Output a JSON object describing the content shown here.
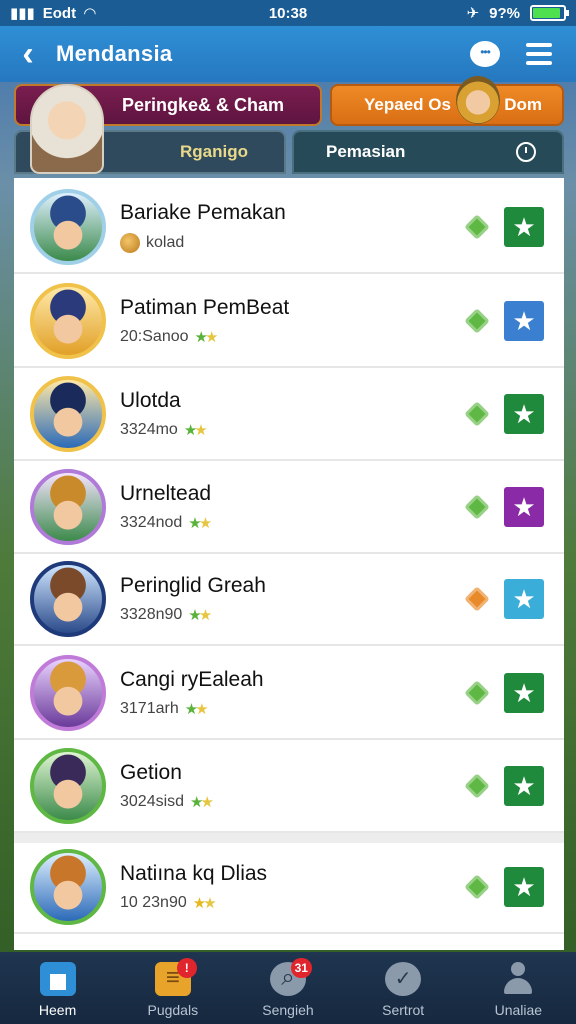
{
  "status_bar": {
    "carrier": "Eodt",
    "time": "10:38",
    "battery": "9?%",
    "battery_level_percent": 90
  },
  "header": {
    "title": "Mendansia"
  },
  "banner": {
    "left_label": "Peringke& & Cham",
    "right_label": "Yepaed Os",
    "right_extra": "Dom"
  },
  "tabs": [
    {
      "label": "Rganigo"
    },
    {
      "label": "Pemasian"
    }
  ],
  "list": [
    {
      "name": "Bariake Pemakan",
      "subtitle": "kolad",
      "sub_icon": "coin",
      "avatar_ring": "#9fd0e8",
      "hat": "#2a4c8a",
      "bg1": "#dff0ff",
      "bg2": "#3b8a4a",
      "diamond_color": "#5fb844",
      "button_color": "#1f8a3c"
    },
    {
      "name": "Patiman PemBeat",
      "subtitle": "20:Sanoo",
      "sub_icon": "stars",
      "avatar_ring": "#f0c24a",
      "hat": "#2a3a7a",
      "bg1": "#ffe9a8",
      "bg2": "#e1a028",
      "diamond_color": "#5fb844",
      "button_color": "#3a7fd0"
    },
    {
      "name": "Ulotda",
      "subtitle": "3324mo",
      "sub_icon": "stars",
      "avatar_ring": "#f0c24a",
      "hat": "#1a2a5a",
      "bg1": "#ffe9a8",
      "bg2": "#2b6ab8",
      "diamond_color": "#5fb844",
      "button_color": "#1f8a3c"
    },
    {
      "name": "Urneltead",
      "subtitle": "3324nod",
      "sub_icon": "stars",
      "avatar_ring": "#b07ad8",
      "hat": "#c88a2a",
      "bg1": "#f5e4ff",
      "bg2": "#3b8a4a",
      "diamond_color": "#5fb844",
      "button_color": "#8a2aa6"
    },
    {
      "name": "Peringlid Greah",
      "subtitle": "3328n90",
      "sub_icon": "stars",
      "avatar_ring": "#1e3a7a",
      "hat": "#7a4a2a",
      "bg1": "#cfe6ff",
      "bg2": "#2a4a8a",
      "diamond_color": "#e88a2a",
      "button_color": "#3aaed8"
    },
    {
      "name": "Cangi ryEaleah",
      "subtitle": "3171arh",
      "sub_icon": "stars",
      "avatar_ring": "#c07ad8",
      "hat": "#d89a3a",
      "bg1": "#e9d2ff",
      "bg2": "#6a3a9a",
      "diamond_color": "#5fb844",
      "button_color": "#1f8a3c"
    },
    {
      "name": "Getion",
      "subtitle": "3024sisd",
      "sub_icon": "stars",
      "avatar_ring": "#5fb844",
      "hat": "#3a2a5a",
      "bg1": "#dff5d2",
      "bg2": "#3b8a4a",
      "diamond_color": "#5fb844",
      "button_color": "#1f8a3c"
    },
    {
      "name": "Natiına kq Dlias",
      "subtitle": "10 23n90",
      "sub_icon": "gold-stars",
      "avatar_ring": "#5fb844",
      "hat": "#c8762a",
      "bg1": "#dff0ff",
      "bg2": "#2b6ab8",
      "diamond_color": "#5fb844",
      "button_color": "#1f8a3c"
    }
  ],
  "bottom_nav": [
    {
      "label": "Heem",
      "icon": "home-icon",
      "active": true,
      "badge": ""
    },
    {
      "label": "Pugdals",
      "icon": "puzzle-icon",
      "active": false,
      "badge": "!"
    },
    {
      "label": "Sengieh",
      "icon": "search-icon",
      "active": false,
      "badge": "31"
    },
    {
      "label": "Sertrot",
      "icon": "check-icon",
      "active": false,
      "badge": ""
    },
    {
      "label": "Unaliae",
      "icon": "user-icon",
      "active": false,
      "badge": ""
    }
  ]
}
